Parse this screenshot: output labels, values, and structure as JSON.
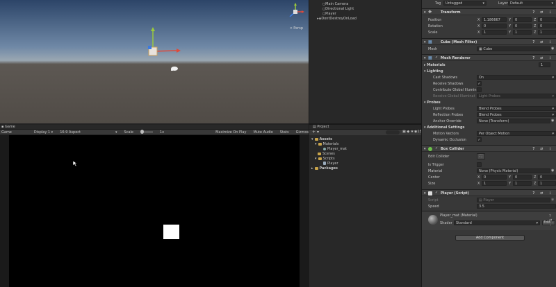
{
  "scene": {
    "persp_label": "< Persp"
  },
  "hierarchy": {
    "items": [
      {
        "label": "Main Camera"
      },
      {
        "label": "Directional Light"
      },
      {
        "label": "Player"
      },
      {
        "label": "DontDestroyOnLoad"
      }
    ]
  },
  "game": {
    "tab_label": "Game",
    "display_mode": "Game",
    "display": "Display 1",
    "aspect": "16:9 Aspect",
    "scale_label": "Scale",
    "scale_value": "1x",
    "maximize": "Maximize On Play",
    "mute": "Mute Audio",
    "stats": "Stats",
    "gizmos": "Gizmos"
  },
  "project": {
    "tab_label": "Project",
    "add_label": "+",
    "count": "13",
    "tree": [
      {
        "label": "Assets",
        "bold": true
      },
      {
        "label": "Materials"
      },
      {
        "label": "Player_mat"
      },
      {
        "label": "Scenes"
      },
      {
        "label": "Scripts"
      },
      {
        "label": "Player"
      },
      {
        "label": "Packages",
        "bold": true
      }
    ]
  },
  "inspector": {
    "tag_label": "Tag",
    "tag_value": "Untagged",
    "layer_label": "Layer",
    "layer_value": "Default",
    "transform": {
      "title": "Transform",
      "position_label": "Position",
      "rotation_label": "Rotation",
      "scale_label": "Scale",
      "position": {
        "x": "1.186667",
        "y": "0",
        "z": "0"
      },
      "rotation": {
        "x": "0",
        "y": "0",
        "z": "0"
      },
      "scale": {
        "x": "1",
        "y": "1",
        "z": "1"
      }
    },
    "mesh_filter": {
      "title": "Cube (Mesh Filter)",
      "mesh_label": "Mesh",
      "mesh_value": "Cube"
    },
    "mesh_renderer": {
      "title": "Mesh Renderer",
      "materials_label": "Materials",
      "materials_count": "1",
      "lighting_label": "Lighting",
      "cast_shadows_label": "Cast Shadows",
      "cast_shadows_value": "On",
      "receive_shadows_label": "Receive Shadows",
      "contribute_gi_label": "Contribute Global Illumin",
      "receive_gi_label": "Receive Global Illuminat",
      "receive_gi_value": "Light Probes",
      "probes_label": "Probes",
      "light_probes_label": "Light Probes",
      "light_probes_value": "Blend Probes",
      "reflection_probes_label": "Reflection Probes",
      "reflection_probes_value": "Blend Probes",
      "anchor_override_label": "Anchor Override",
      "anchor_override_value": "None (Transform)",
      "additional_label": "Additional Settings",
      "motion_vectors_label": "Motion Vectors",
      "motion_vectors_value": "Per Object Motion",
      "dynamic_occlusion_label": "Dynamic Occlusion"
    },
    "box_collider": {
      "title": "Box Collider",
      "edit_label": "Edit Collider",
      "is_trigger_label": "Is Trigger",
      "material_label": "Material",
      "material_value": "None (Physic Material)",
      "center_label": "Center",
      "size_label": "Size",
      "center": {
        "x": "0",
        "y": "0",
        "z": "0"
      },
      "size": {
        "x": "1",
        "y": "1",
        "z": "1"
      }
    },
    "player_script": {
      "title": "Player (Script)",
      "script_label": "Script",
      "script_value": "Player",
      "speed_label": "Speed",
      "speed_value": "3.5"
    },
    "material": {
      "name": "Player_mat (Material)",
      "shader_label": "Shader",
      "shader_value": "Standard",
      "edit_label": "Edit..."
    },
    "add_component": "Add Component"
  },
  "colors": {
    "x_axis": "#e04a3a",
    "y_axis": "#9ac93c",
    "z_axis": "#3d7be0",
    "selection_blue": "#2c5d87"
  }
}
